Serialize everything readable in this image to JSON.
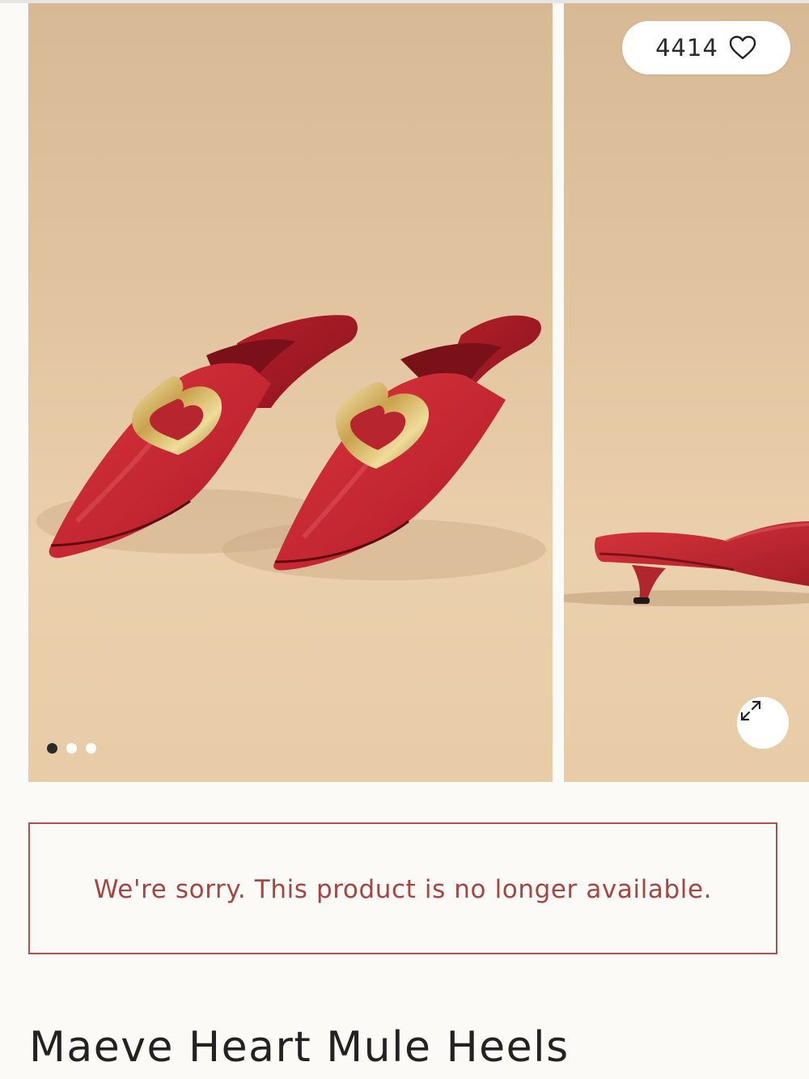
{
  "gallery": {
    "likes_count": "4414",
    "like_icon": "heart-outline-icon",
    "expand_icon": "expand-arrows-icon",
    "slide_count": 3,
    "active_slide": 1
  },
  "notice": {
    "message": "We're sorry. This product is no longer available.",
    "color": "#a8443f"
  },
  "product": {
    "title": "Maeve Heart Mule Heels",
    "color": "#c52a33"
  }
}
